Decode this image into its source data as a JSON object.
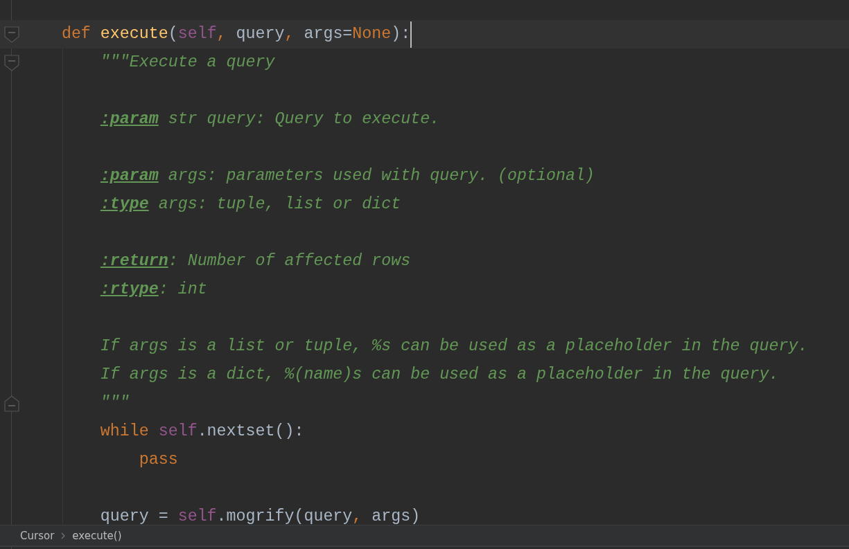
{
  "lines": [
    {
      "current": true,
      "fold": {
        "kind": "start",
        "expanded": true
      },
      "tokens": [
        {
          "kind": "keyword",
          "text": "def"
        },
        {
          "kind": "function",
          "text": " execute"
        },
        {
          "kind": "plain",
          "text": "("
        },
        {
          "kind": "self",
          "text": "self"
        },
        {
          "kind": "keyword",
          "text": ","
        },
        {
          "kind": "plain",
          "text": " query"
        },
        {
          "kind": "keyword",
          "text": ","
        },
        {
          "kind": "plain",
          "text": " args="
        },
        {
          "kind": "keyword",
          "text": "None"
        },
        {
          "kind": "plain",
          "text": "):"
        }
      ],
      "children": [
        {
          "current": false,
          "fold": {
            "kind": "start",
            "expanded": true
          },
          "tokens": [
            {
              "kind": "doc",
              "text": "\"\"\"Execute a query"
            }
          ]
        },
        {
          "current": false
        },
        {
          "current": false,
          "tokens": [
            {
              "kind": "doctag",
              "text": ":param"
            },
            {
              "kind": "doc",
              "text": " str query: Query to execute."
            }
          ]
        },
        {
          "current": false
        },
        {
          "current": false,
          "tokens": [
            {
              "kind": "doctag",
              "text": ":param"
            },
            {
              "kind": "doc",
              "text": " args: parameters used with query. (optional)"
            }
          ]
        },
        {
          "current": false,
          "tokens": [
            {
              "kind": "doctag",
              "text": ":type"
            },
            {
              "kind": "doc",
              "text": " args: tuple, list or dict"
            }
          ]
        },
        {
          "current": false
        },
        {
          "current": false,
          "tokens": [
            {
              "kind": "doctag",
              "text": ":return"
            },
            {
              "kind": "doc",
              "text": ": Number of affected rows"
            }
          ]
        },
        {
          "current": false,
          "tokens": [
            {
              "kind": "doctag",
              "text": ":rtype"
            },
            {
              "kind": "doc",
              "text": ": int"
            }
          ]
        },
        {
          "current": false
        },
        {
          "current": false,
          "tokens": [
            {
              "kind": "doc",
              "text": "If args is a list or tuple, %s can be used as a placeholder in the query."
            }
          ]
        },
        {
          "current": false,
          "tokens": [
            {
              "kind": "doc",
              "text": "If args is a dict, %(name)s can be used as a placeholder in the query."
            }
          ]
        },
        {
          "current": false,
          "fold": {
            "kind": "end",
            "expanded": true
          },
          "tokens": [
            {
              "kind": "doc",
              "text": "\"\"\""
            }
          ]
        },
        {
          "current": false,
          "tokens": [
            {
              "kind": "keyword",
              "text": "while"
            },
            {
              "kind": "self",
              "text": " self"
            },
            {
              "kind": "plain",
              "text": ".nextset():"
            }
          ],
          "children": [
            {
              "current": false,
              "tokens": [
                {
                  "kind": "keyword",
                  "text": "pass"
                }
              ]
            }
          ]
        },
        {
          "current": false
        },
        {
          "current": false,
          "tokens": [
            {
              "kind": "plain",
              "text": "query ="
            },
            {
              "kind": "self",
              "text": " self"
            },
            {
              "kind": "plain",
              "text": ".mogrify(query"
            },
            {
              "kind": "keyword",
              "text": ","
            },
            {
              "kind": "plain",
              "text": " args)"
            }
          ]
        }
      ]
    }
  ],
  "breadcrumb": [
    "Cursor",
    "execute()"
  ]
}
